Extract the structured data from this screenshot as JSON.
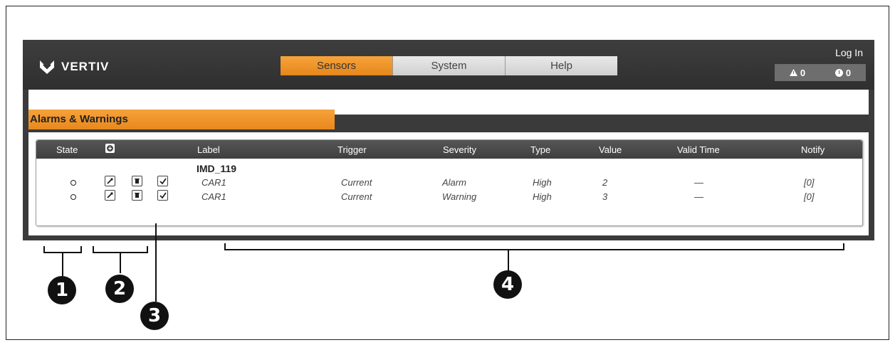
{
  "brand": {
    "name": "VERTIV"
  },
  "nav": {
    "tabs": [
      {
        "label": "Sensors",
        "active": true
      },
      {
        "label": "System",
        "active": false
      },
      {
        "label": "Help",
        "active": false
      }
    ]
  },
  "header": {
    "login_label": "Log In",
    "alarm_count": "0",
    "warning_count": "0"
  },
  "section": {
    "title": "Alarms & Warnings"
  },
  "table": {
    "columns": [
      "State",
      "Label",
      "Trigger",
      "Severity",
      "Type",
      "Value",
      "Valid Time",
      "Notify"
    ],
    "group": "IMD_119",
    "rows": [
      {
        "label": "CAR1",
        "trigger": "Current",
        "severity": "Alarm",
        "type": "High",
        "value": "2",
        "valid_time": "—",
        "notify": "[0]"
      },
      {
        "label": "CAR1",
        "trigger": "Current",
        "severity": "Warning",
        "type": "High",
        "value": "3",
        "valid_time": "—",
        "notify": "[0]"
      }
    ]
  },
  "callouts": [
    "1",
    "2",
    "3",
    "4"
  ],
  "colors": {
    "accent": "#E8891F",
    "header": "#3a3a3a"
  }
}
